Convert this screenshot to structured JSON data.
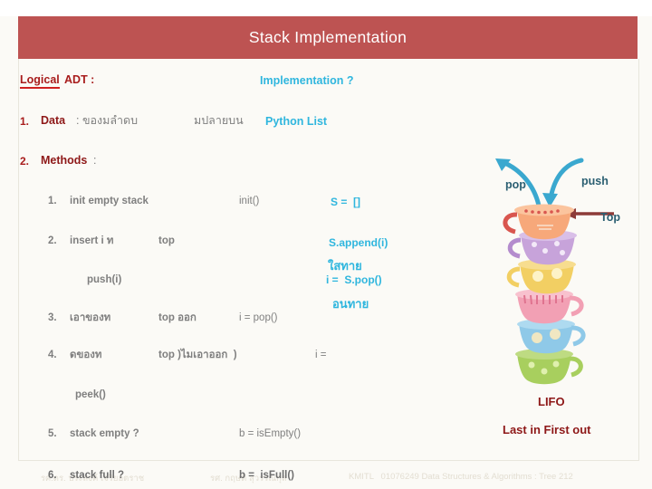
{
  "slide": {
    "title": "Stack Implementation",
    "accent_color": "#bd5352",
    "background_color": "#fbfaf6",
    "cyan": "#2fb6de",
    "red": "#a81c1c"
  },
  "headers": {
    "logical_underlined": "Logical",
    "logical_rest": " ADT :",
    "implementation": "Implementation ?"
  },
  "sections": {
    "data_num": "1.",
    "data_label": "Data",
    "data_colon": ": ของมลำดบ",
    "data_thai2": "มปลายบน",
    "data_impl": "Python List",
    "methods_num": "2.",
    "methods_label": "Methods",
    "methods_colon": ":"
  },
  "methods": [
    {
      "num": "1.",
      "op": "init empty stack",
      "api": "init()",
      "code": "S =  []"
    },
    {
      "num": "2.",
      "op": "insert i ท",
      "op2": "top",
      "api": "push(i)",
      "code": "S.append(i)",
      "thai": "ใสทาย"
    },
    {
      "num": "3.",
      "op": "เอาของท",
      "op2": "top ออก",
      "api": "i = pop()",
      "code": "i =  S.pop()",
      "thai": "อนทาย"
    },
    {
      "num": "4.",
      "op": "ดของท",
      "op2": "top )ไมเอาออก  )",
      "api": "i =",
      "api2": "peek()"
    },
    {
      "num": "5.",
      "op": "stack empty ?",
      "api": "b = isEmpty()"
    },
    {
      "num": "6.",
      "op": "stack full ?",
      "api": "b =  isFull()"
    }
  ],
  "diagram": {
    "pop_label": "pop",
    "push_label": "push",
    "top_label": "Top",
    "lifo": "LIFO",
    "lifo_expand": "Last in First out",
    "cup_colors": [
      "#f7a87a",
      "#c7a3da",
      "#f2cf63",
      "#f2a0b4",
      "#8fc9e8",
      "#a8cf5e"
    ]
  },
  "footer": {
    "faint_left": "รศ.ดร. ประสงค์ เจริยอตราช",
    "faint_mid": "รศ. กฤษติ สุวรรณกุล",
    "faint_right": "KMITL   01076249 Data Structures & Algorithms : Tree 212",
    "strong_num": "6.",
    "strong_op": "stack full ?",
    "strong_api": "b =  isFull()"
  }
}
